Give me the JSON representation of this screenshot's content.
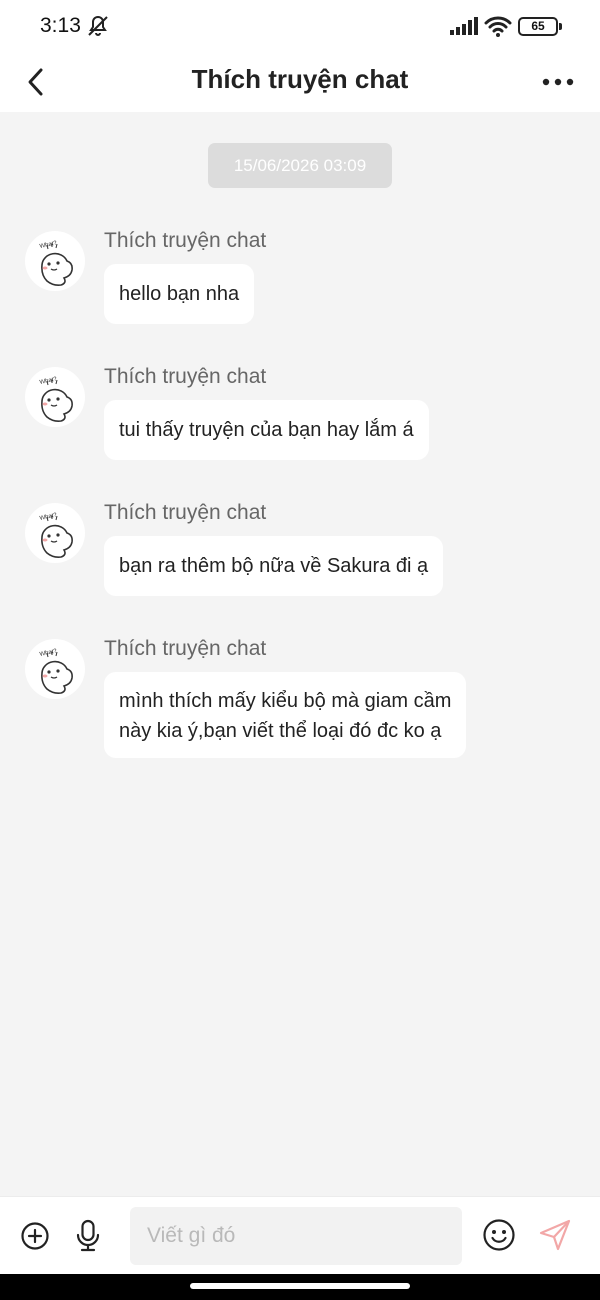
{
  "status_bar": {
    "time": "3:13",
    "battery": "65"
  },
  "header": {
    "title": "Thích truyện chat"
  },
  "date_divider": "15/06/2026 03:09",
  "avatar_caption": "What?",
  "messages": [
    {
      "sender": "Thích truyện chat",
      "lines": [
        "hello bạn nha"
      ]
    },
    {
      "sender": "Thích truyện chat",
      "lines": [
        "tui thấy truyện của bạn hay lắm á"
      ]
    },
    {
      "sender": "Thích truyện chat",
      "lines": [
        "bạn ra thêm bộ nữa về Sakura đi ạ"
      ]
    },
    {
      "sender": "Thích truyện chat",
      "lines": [
        "mình thích mấy kiểu bộ mà giam cầm",
        "này kia ý,bạn viết thể loại đó đc ko ạ"
      ]
    }
  ],
  "composer": {
    "placeholder": "Viết gì đó",
    "value": ""
  },
  "colors": {
    "background": "#f4f4f4",
    "send_icon": "#f2a7a7",
    "date_chip": "#dcdcdc"
  },
  "icons": [
    "back-icon",
    "more-icon",
    "add-icon",
    "microphone-icon",
    "emoji-icon",
    "send-icon"
  ]
}
